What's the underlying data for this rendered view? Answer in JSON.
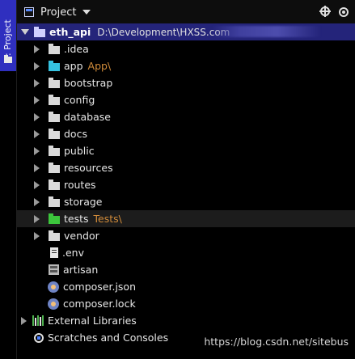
{
  "sidebar": {
    "tab_label": "1: Project"
  },
  "header": {
    "title": "Project"
  },
  "tree": {
    "root": {
      "name": "eth_api",
      "path": "D:\\Development\\HXSS.com"
    },
    "folders": [
      {
        "name": ".idea",
        "tag": ""
      },
      {
        "name": "app",
        "tag": "App\\"
      },
      {
        "name": "bootstrap",
        "tag": ""
      },
      {
        "name": "config",
        "tag": ""
      },
      {
        "name": "database",
        "tag": ""
      },
      {
        "name": "docs",
        "tag": ""
      },
      {
        "name": "public",
        "tag": ""
      },
      {
        "name": "resources",
        "tag": ""
      },
      {
        "name": "routes",
        "tag": ""
      },
      {
        "name": "storage",
        "tag": ""
      },
      {
        "name": "tests",
        "tag": "Tests\\"
      },
      {
        "name": "vendor",
        "tag": ""
      }
    ],
    "files": [
      {
        "name": ".env"
      },
      {
        "name": "artisan"
      },
      {
        "name": "composer.json"
      },
      {
        "name": "composer.lock"
      }
    ],
    "external_libraries": "External Libraries",
    "scratches": "Scratches and Consoles"
  },
  "watermark": "https://blog.csdn.net/sitebus",
  "colors": {
    "root_row_bg": "#24247a",
    "side_tab_bg": "#2f2fbf",
    "tag_color": "#d08b3a",
    "app_folder": "#35c2e0",
    "tests_folder": "#3cc63c"
  }
}
